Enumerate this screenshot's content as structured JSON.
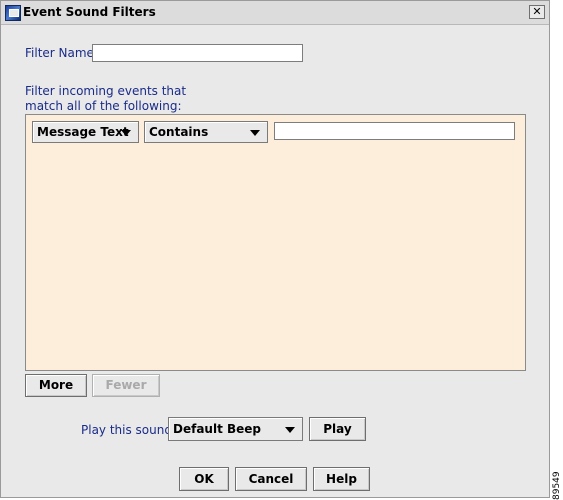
{
  "window": {
    "title": "Event Sound Filters",
    "close_glyph": "✕"
  },
  "filter_name": {
    "label": "Filter Name:",
    "value": ""
  },
  "instructions": {
    "line1": "Filter incoming events that",
    "line2": "match all of the following:"
  },
  "criteria": {
    "field": "Message Text",
    "operator": "Contains",
    "value": ""
  },
  "more_fewer": {
    "more": "More",
    "fewer": "Fewer"
  },
  "sound": {
    "label": "Play this sound:",
    "selected": "Default Beep",
    "play": "Play"
  },
  "footer": {
    "ok": "OK",
    "cancel": "Cancel",
    "help": "Help"
  },
  "figure_id": "89549"
}
